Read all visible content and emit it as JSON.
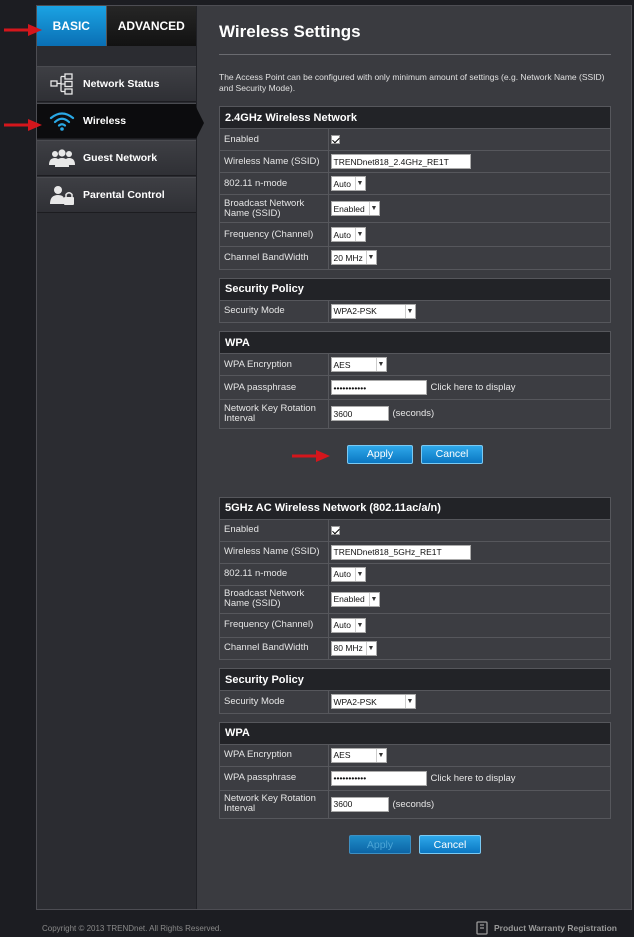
{
  "sidebar": {
    "tabs": [
      {
        "label": "BASIC",
        "active": true
      },
      {
        "label": "ADVANCED",
        "active": false
      }
    ],
    "items": [
      {
        "label": "Network Status",
        "icon": "network-tree-icon"
      },
      {
        "label": "Wireless",
        "icon": "wifi-icon",
        "active": true
      },
      {
        "label": "Guest Network",
        "icon": "users-icon"
      },
      {
        "label": "Parental Control",
        "icon": "user-lock-icon"
      }
    ]
  },
  "page": {
    "title": "Wireless Settings",
    "intro": "The Access Point can be configured with only minimum amount of settings (e.g. Network Name (SSID) and Security Mode)."
  },
  "net24": {
    "header": "2.4GHz Wireless Network",
    "enabled_label": "Enabled",
    "enabled": true,
    "ssid_label": "Wireless Name (SSID)",
    "ssid_value": "TRENDnet818_2.4GHz_RE1T",
    "mode_label": "802.11 n-mode",
    "mode_value": "Auto",
    "broadcast_label": "Broadcast Network Name (SSID)",
    "broadcast_value": "Enabled",
    "freq_label": "Frequency (Channel)",
    "freq_value": "Auto",
    "bw_label": "Channel BandWidth",
    "bw_value": "20 MHz"
  },
  "sec24": {
    "header": "Security Policy",
    "mode_label": "Security Mode",
    "mode_value": "WPA2-PSK"
  },
  "wpa24": {
    "header": "WPA",
    "enc_label": "WPA Encryption",
    "enc_value": "AES",
    "pass_label": "WPA passphrase",
    "pass_value": "•••••••••••",
    "display_link": "Click here to display",
    "rot_label": "Network Key Rotation Interval",
    "rot_value": "3600",
    "rot_unit": "(seconds)"
  },
  "buttons1": {
    "apply": "Apply",
    "cancel": "Cancel"
  },
  "net5": {
    "header": "5GHz AC Wireless Network (802.11ac/a/n)",
    "enabled_label": "Enabled",
    "enabled": true,
    "ssid_label": "Wireless Name (SSID)",
    "ssid_value": "TRENDnet818_5GHz_RE1T",
    "mode_label": "802.11 n-mode",
    "mode_value": "Auto",
    "broadcast_label": "Broadcast Network Name (SSID)",
    "broadcast_value": "Enabled",
    "freq_label": "Frequency (Channel)",
    "freq_value": "Auto",
    "bw_label": "Channel BandWidth",
    "bw_value": "80 MHz"
  },
  "sec5": {
    "header": "Security Policy",
    "mode_label": "Security Mode",
    "mode_value": "WPA2-PSK"
  },
  "wpa5": {
    "header": "WPA",
    "enc_label": "WPA Encryption",
    "enc_value": "AES",
    "pass_label": "WPA passphrase",
    "pass_value": "•••••••••••",
    "display_link": "Click here to display",
    "rot_label": "Network Key Rotation Interval",
    "rot_value": "3600",
    "rot_unit": "(seconds)"
  },
  "buttons2": {
    "apply": "Apply",
    "cancel": "Cancel"
  },
  "footer": {
    "copyright": "Copyright © 2013 TRENDnet. All Rights Reserved.",
    "warranty": "Product Warranty Registration",
    "warranty_icon": "warranty-icon"
  },
  "colors": {
    "accent_blue": "#1ba3e3",
    "annotation_red": "#d4161c",
    "panel_header": "#222327"
  }
}
